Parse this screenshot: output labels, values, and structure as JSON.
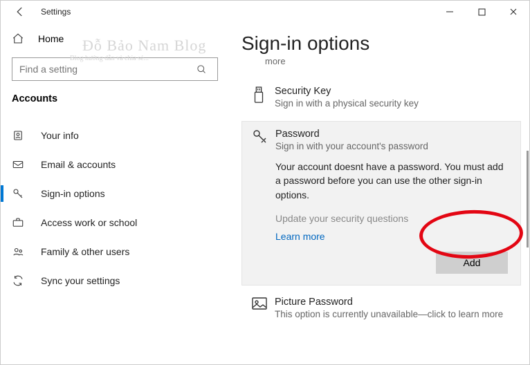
{
  "window": {
    "title": "Settings"
  },
  "sidebar": {
    "home": "Home",
    "search_placeholder": "Find a setting",
    "section": "Accounts",
    "items": [
      {
        "label": "Your info"
      },
      {
        "label": "Email & accounts"
      },
      {
        "label": "Sign-in options"
      },
      {
        "label": "Access work or school"
      },
      {
        "label": "Family & other users"
      },
      {
        "label": "Sync your settings"
      }
    ]
  },
  "watermark": {
    "main": "Đỗ Bảo Nam Blog",
    "sub": "Blog hướng dẫn và chia sẻ..."
  },
  "page": {
    "title": "Sign-in options",
    "more": "more"
  },
  "options": {
    "security_key": {
      "name": "Security Key",
      "desc": "Sign in with a physical security key"
    },
    "password": {
      "name": "Password",
      "desc": "Sign in with your account's password",
      "message": "Your account doesnt have a password. You must add a password before you can use the other sign-in options.",
      "update": "Update your security questions",
      "learn": "Learn more",
      "add_label": "Add"
    },
    "picture": {
      "name": "Picture Password",
      "desc": "This option is currently unavailable—click to learn more"
    }
  }
}
